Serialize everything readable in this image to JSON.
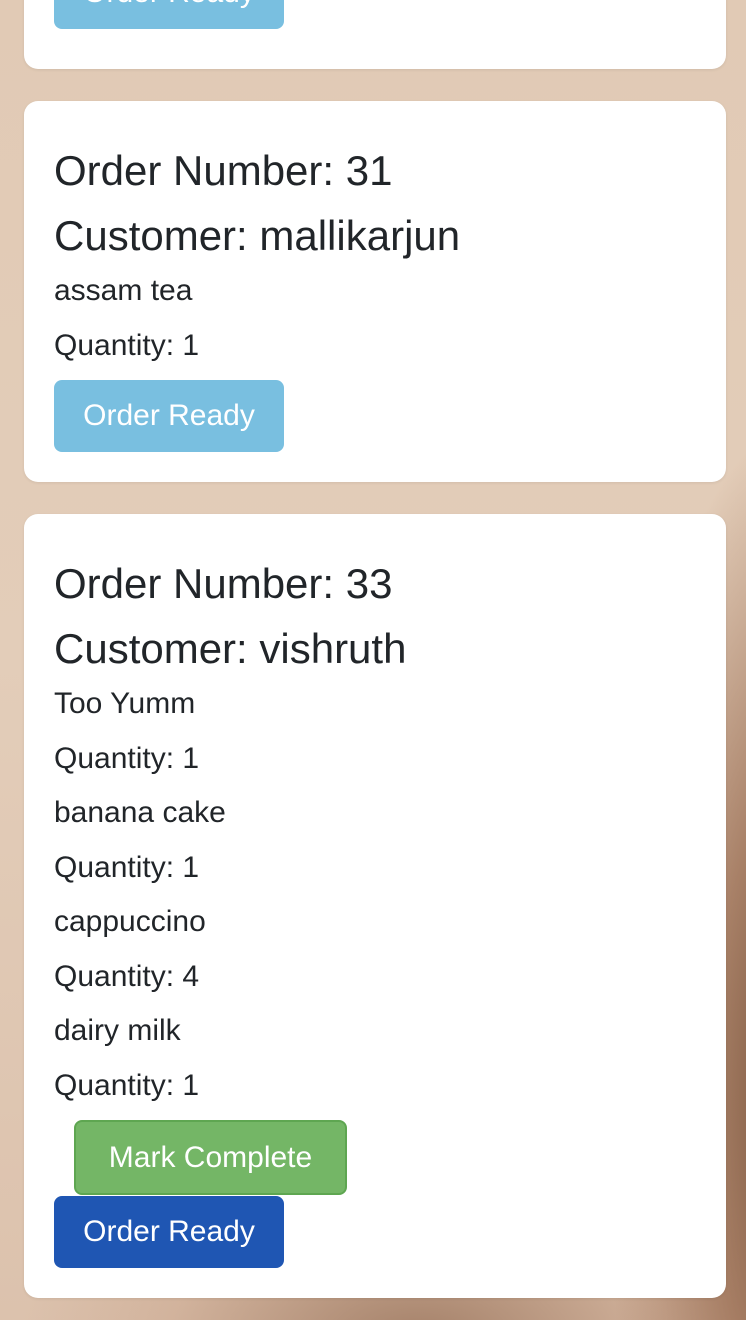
{
  "colors": {
    "order_ready_light": "#79bfe0",
    "order_ready_active": "#1f56b3",
    "mark_complete": "#74b666",
    "card_background": "#ffffff",
    "text": "#212529"
  },
  "orders": [
    {
      "order_ready_label": "Order Ready"
    },
    {
      "order_number_label": "Order Number: 31",
      "customer_label": "Customer: mallikarjun",
      "items": [
        {
          "name": "assam tea",
          "quantity_label": "Quantity: 1"
        }
      ],
      "order_ready_label": "Order Ready"
    },
    {
      "order_number_label": "Order Number: 33",
      "customer_label": "Customer: vishruth",
      "items": [
        {
          "name": "Too Yumm",
          "quantity_label": "Quantity: 1"
        },
        {
          "name": "banana cake",
          "quantity_label": "Quantity: 1"
        },
        {
          "name": "cappuccino",
          "quantity_label": "Quantity: 4"
        },
        {
          "name": "dairy milk",
          "quantity_label": "Quantity: 1"
        }
      ],
      "mark_complete_label": "Mark Complete",
      "order_ready_label": "Order Ready"
    }
  ]
}
